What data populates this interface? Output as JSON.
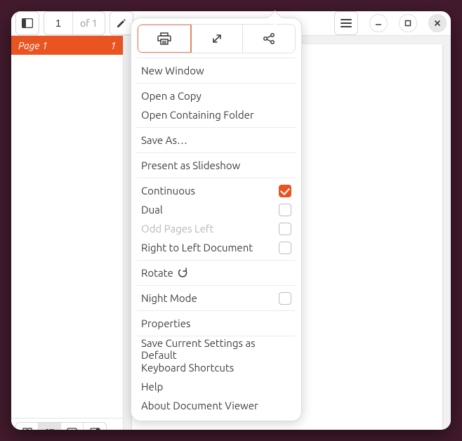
{
  "toolbar": {
    "page_current": "1",
    "page_total": "of 1"
  },
  "sidepanel": {
    "thumb_label": "Page 1",
    "thumb_num": "1"
  },
  "menu": {
    "new_window": "New Window",
    "open_copy": "Open a Copy",
    "open_containing": "Open Containing Folder",
    "save_as": "Save As…",
    "present": "Present as Slideshow",
    "continuous": "Continuous",
    "dual": "Dual",
    "odd_pages_left": "Odd Pages Left",
    "rtl": "Right to Left Document",
    "rotate": "Rotate",
    "night_mode": "Night Mode",
    "properties": "Properties",
    "save_settings": "Save Current Settings as Default",
    "shortcuts": "Keyboard Shortcuts",
    "help": "Help",
    "about": "About Document Viewer"
  }
}
